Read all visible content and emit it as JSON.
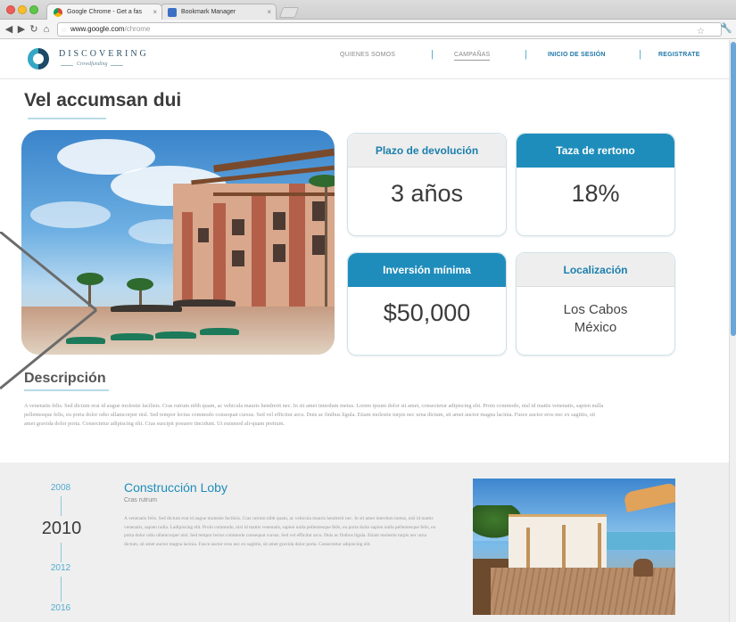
{
  "browser": {
    "tabs": [
      {
        "label": "Google Chrome - Get a fas"
      },
      {
        "label": "Bookmark Manager"
      }
    ],
    "url_host": "www.google.com",
    "url_path": "/chrome"
  },
  "header": {
    "logo_title": "DISCOVERING",
    "logo_subtitle": "Crowdfunding",
    "nav": {
      "quienes": "QUIENES SOMOS",
      "campanas": "CAMPAÑAS",
      "login": "INICIO DE SESIÓN",
      "register": "REGISTRATE"
    },
    "nav_separator": "|"
  },
  "page": {
    "title": "Vel accumsan dui"
  },
  "stats": [
    {
      "label": "Plazo de devolución",
      "value": "3 años"
    },
    {
      "label": "Taza de rertono",
      "value": "18%"
    },
    {
      "label": "Inversión mínima",
      "value": "$50,000"
    },
    {
      "label": "Localización",
      "value_line1": "Los Cabos",
      "value_line2": "México"
    }
  ],
  "description": {
    "title": "Descripción",
    "body": "A venenatis felis. Sed dictum erat id augue molestie facilisis. Cras rutrum nibh quam, ac vehicula mauris hendrerit nec. In sit amet interdum metus. Lorem ipsum dolor sit amet, consectetur adipiscing elit. Proin commodo, nisl id mattis venenatis, sapien nulla pellentesque felis, eu porta dolor odio ullamcorper nisl. Sed tempor lectus commodo consequat cursus. Sed vel efficitur arcu. Duis ac finibus ligula. Etiam molestie turpis nec urna dictum, sit amet auctor magna lacinia. Fusce auctor eros nec ex sagittis, sit amet gravida dolor porta. Consectetur adipiscing elit. Cras suscipit posuere tincidunt. Ut euismod ali-quam pretium."
  },
  "timeline": {
    "years": [
      "2008",
      "2010",
      "2012",
      "2016"
    ],
    "active_year": "2010",
    "title": "Construcción Loby",
    "subtitle": "Cras rutrum",
    "body": "A venenatis felis. Sed dictum erat id augue molestie facilisis. Cras rutrum nibh quam, ac vehicula mauris hendrerit nec. In sit amet interdum metus, nisl id mattis venenatis, sapien nulla. Ladipiscing elit. Proin commodo, nisl id mattis venenatis, sapien nulla pellentesque felis, eu porta dolor sapien nulla pellentesque felis, eu porta dolor odio ullamcorper nisl. Sed tempor lectus commodo consequat cursus. Sed vel efficitur arcu. Duis ac finibus ligula. Etiam molestie turpis nec urna dictum, sit amet auctor magna lacinia. Fusce auctor eros nec ex sagittis, sit amet gravida dolor porta. Consectetur adipiscing elit."
  },
  "colors": {
    "accent_blue": "#1f8dbb",
    "light_gray": "#eeeeee"
  }
}
